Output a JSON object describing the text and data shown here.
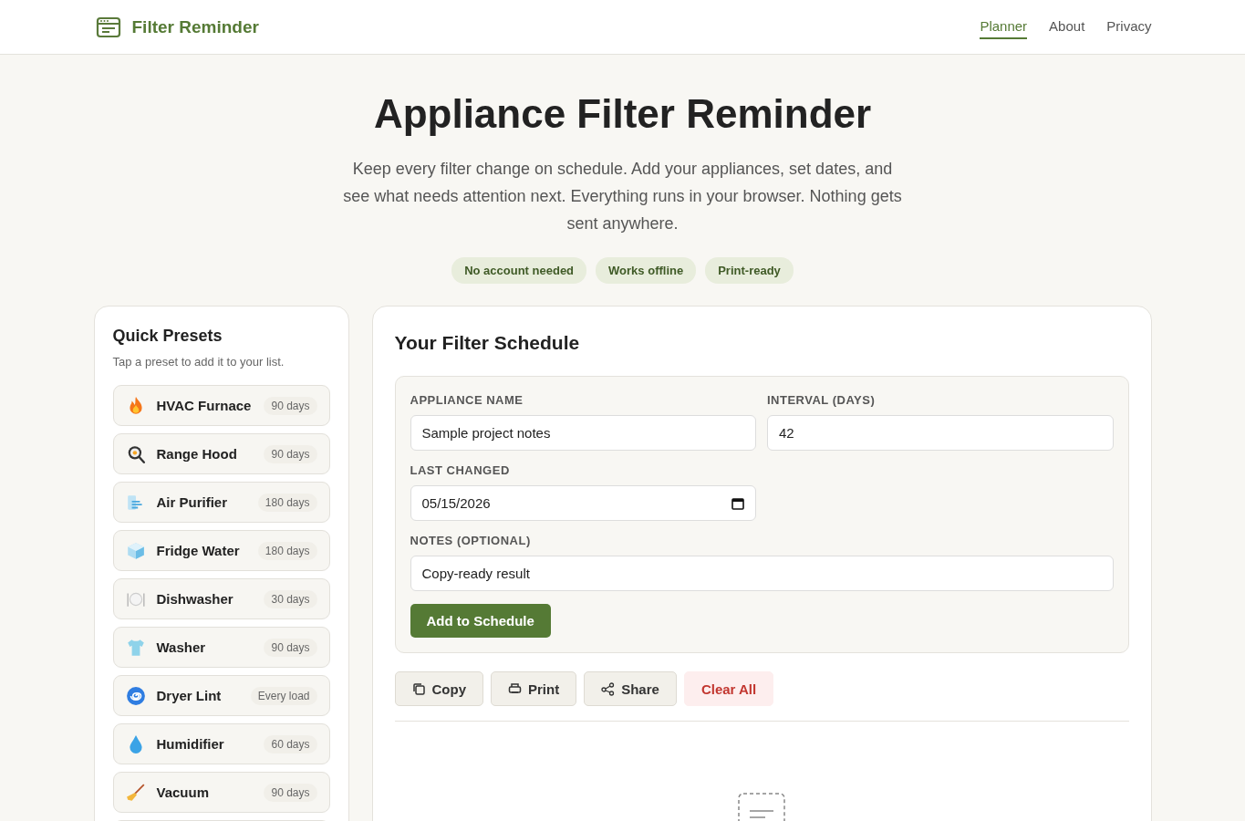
{
  "header": {
    "brand": "Filter Reminder",
    "nav": [
      {
        "label": "Planner",
        "selected": true
      },
      {
        "label": "About",
        "selected": false
      },
      {
        "label": "Privacy",
        "selected": false
      }
    ]
  },
  "hero": {
    "title": "Appliance Filter Reminder",
    "subtitle": "Keep every filter change on schedule. Add your appliances, set dates, and see what needs attention next. Everything runs in your browser. Nothing gets sent anywhere.",
    "badges": [
      "No account needed",
      "Works offline",
      "Print-ready"
    ]
  },
  "presets": {
    "title": "Quick Presets",
    "hint": "Tap a preset to add it to your list.",
    "items": [
      {
        "name": "HVAC Furnace",
        "interval": "90 days"
      },
      {
        "name": "Range Hood",
        "interval": "90 days"
      },
      {
        "name": "Air Purifier",
        "interval": "180 days"
      },
      {
        "name": "Fridge Water",
        "interval": "180 days"
      },
      {
        "name": "Dishwasher",
        "interval": "30 days"
      },
      {
        "name": "Washer",
        "interval": "90 days"
      },
      {
        "name": "Dryer Lint",
        "interval": "Every load"
      },
      {
        "name": "Humidifier",
        "interval": "60 days"
      },
      {
        "name": "Vacuum",
        "interval": "90 days"
      }
    ]
  },
  "schedule": {
    "title": "Your Filter Schedule",
    "form": {
      "name_label": "APPLIANCE NAME",
      "name_value": "Sample project notes",
      "interval_label": "INTERVAL (DAYS)",
      "interval_value": "42",
      "date_label": "LAST CHANGED",
      "date_value": "05/15/2026",
      "notes_label": "NOTES (OPTIONAL)",
      "notes_value": "Copy-ready result",
      "submit": "Add to Schedule"
    },
    "actions": [
      {
        "kind": "copy",
        "label": "Copy"
      },
      {
        "kind": "print",
        "label": "Print"
      },
      {
        "kind": "share",
        "label": "Share"
      },
      {
        "kind": "danger",
        "label": "Clear All"
      }
    ]
  }
}
